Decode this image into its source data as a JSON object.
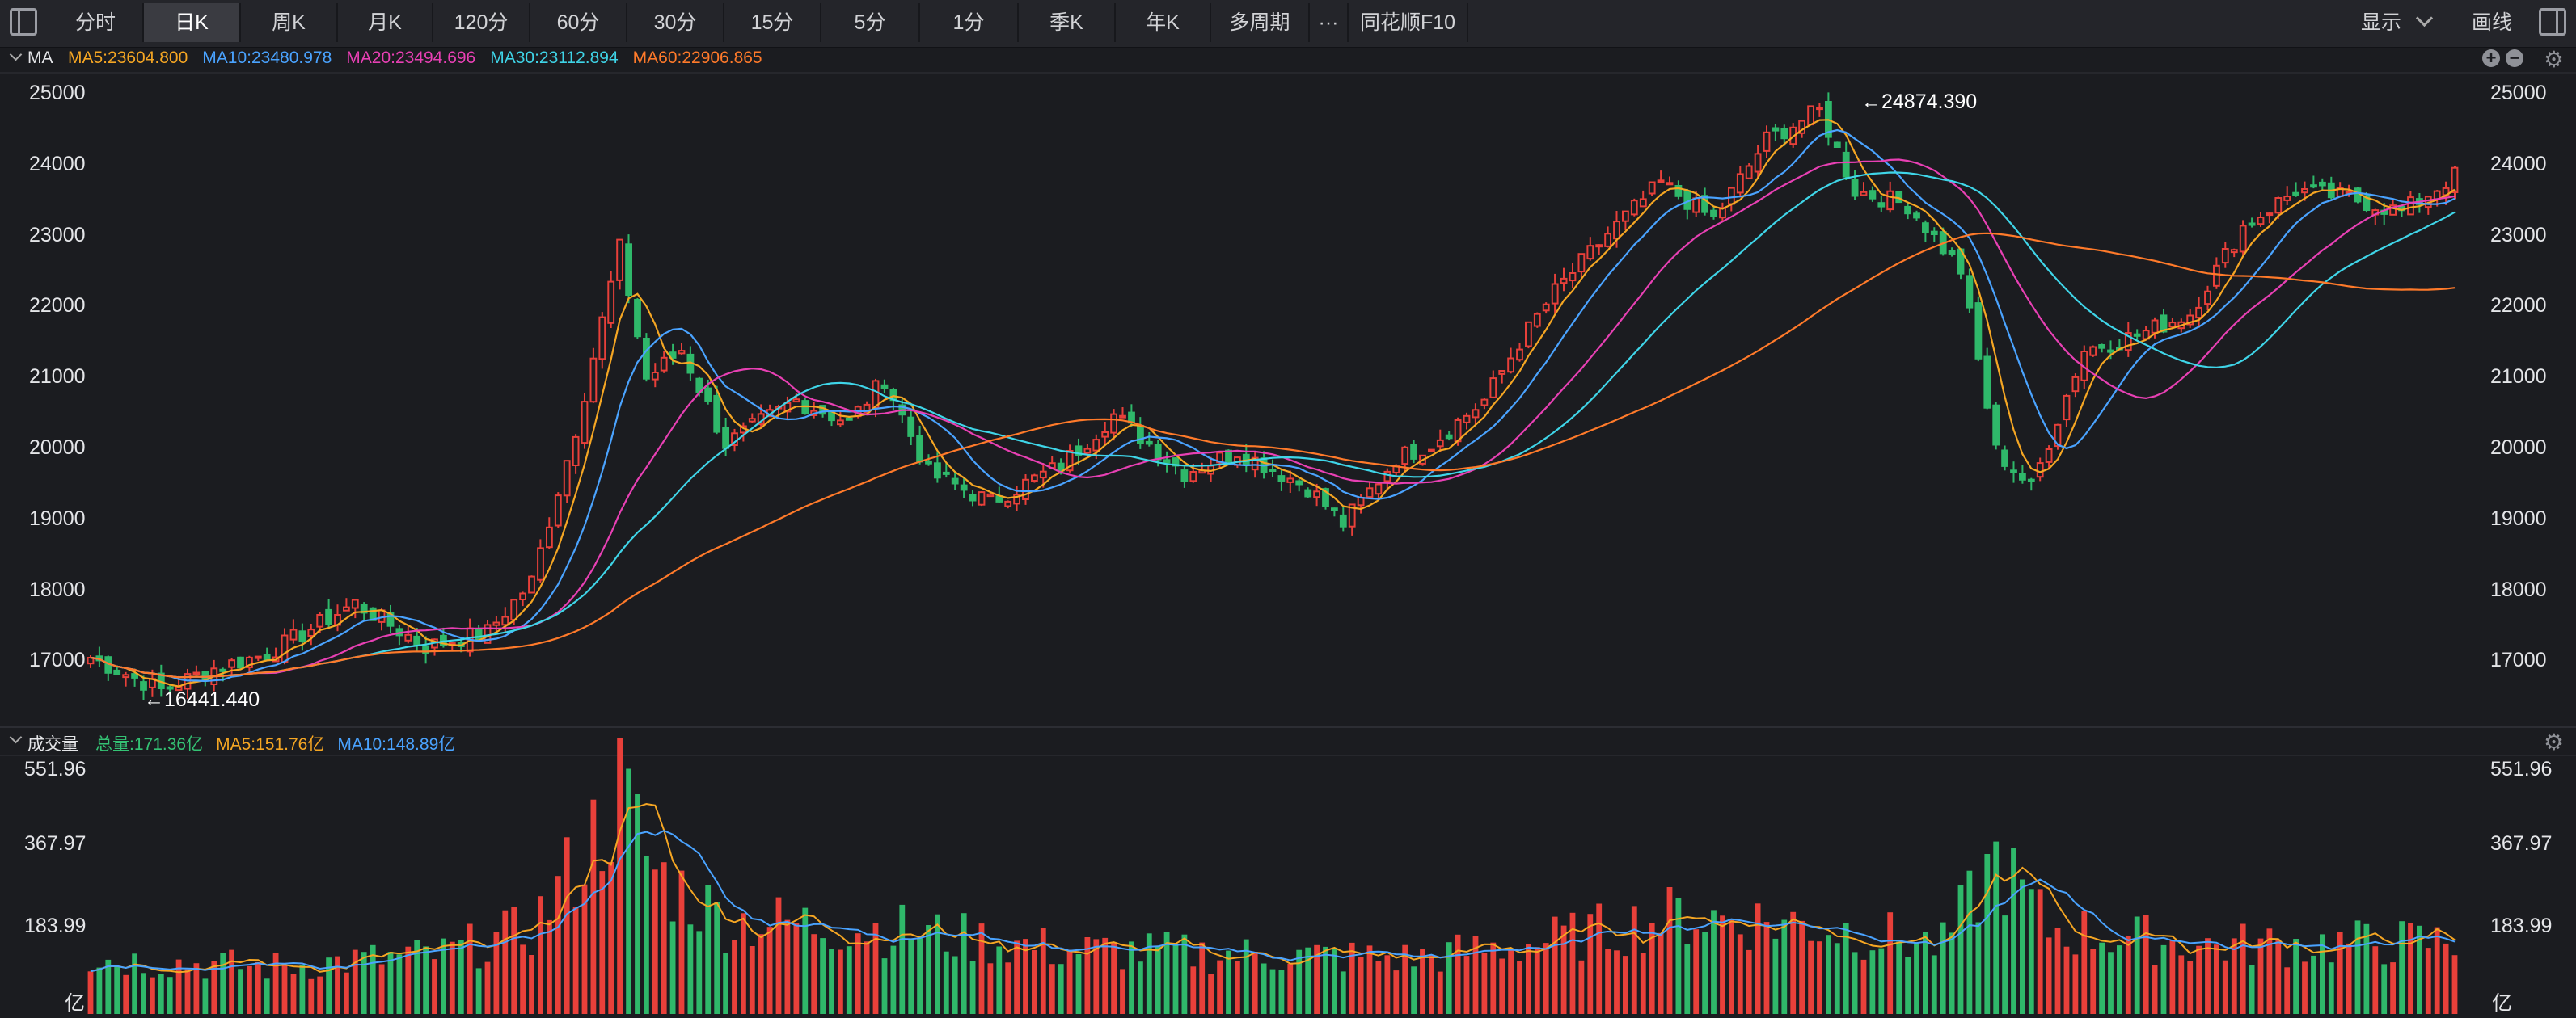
{
  "toolbar": {
    "tabs": [
      "分时",
      "日K",
      "周K",
      "月K",
      "120分",
      "60分",
      "30分",
      "15分",
      "5分",
      "1分",
      "季K",
      "年K",
      "多周期"
    ],
    "active_tab": "日K",
    "more_label": "···",
    "f10_label": "同花顺F10",
    "display_label": "显示",
    "draw_label": "画线"
  },
  "price_panel": {
    "title": "MA",
    "ma_labels": [
      {
        "text": "MA5:23604.800",
        "color": "#f5a623"
      },
      {
        "text": "MA10:23480.978",
        "color": "#4aa3ff"
      },
      {
        "text": "MA20:23494.696",
        "color": "#e840b4"
      },
      {
        "text": "MA30:23112.894",
        "color": "#3fd5e8"
      },
      {
        "text": "MA60:22906.865",
        "color": "#ff7a2a"
      }
    ],
    "y_ticks": [
      "25000",
      "24000",
      "23000",
      "22000",
      "21000",
      "20000",
      "19000",
      "18000",
      "17000"
    ],
    "high_label": "←24874.390",
    "low_label": "←16441.440"
  },
  "volume_panel": {
    "title": "成交量",
    "labels": [
      {
        "text": "总量:171.36亿",
        "color": "#34c274"
      },
      {
        "text": "MA5:151.76亿",
        "color": "#f5a623"
      },
      {
        "text": "MA10:148.89亿",
        "color": "#4aa3ff"
      }
    ],
    "y_ticks": [
      "551.96",
      "367.97",
      "183.99"
    ],
    "unit": "亿"
  },
  "colors": {
    "up": "#e8403a",
    "down": "#2fb86a",
    "ma5": "#f5a623",
    "ma10": "#4aa3ff",
    "ma20": "#e840b4",
    "ma30": "#3fd5e8",
    "ma60": "#ff7a2a"
  },
  "icons": [
    "sidebar-toggle-icon",
    "chevron-down-icon",
    "sidebar-right-icon",
    "zoom-in-icon",
    "zoom-out-icon",
    "settings-gear-icon"
  ],
  "chart_data": {
    "type": "candlestick",
    "candle_count": 160,
    "price_range": [
      16441.44,
      24874.39
    ],
    "y_axis_range": [
      16300,
      25200
    ],
    "volume_axis_range": [
      0,
      600
    ],
    "anchors": [
      {
        "i": 0,
        "close": 17150
      },
      {
        "i": 8,
        "close": 16700
      },
      {
        "i": 14,
        "close": 17000
      },
      {
        "i": 20,
        "close": 17200
      },
      {
        "i": 30,
        "close": 17900
      },
      {
        "i": 38,
        "close": 17300
      },
      {
        "i": 45,
        "close": 17500
      },
      {
        "i": 50,
        "close": 18200
      },
      {
        "i": 55,
        "close": 20300
      },
      {
        "i": 60,
        "close": 22800
      },
      {
        "i": 63,
        "close": 21000
      },
      {
        "i": 67,
        "close": 21400
      },
      {
        "i": 72,
        "close": 20100
      },
      {
        "i": 80,
        "close": 20700
      },
      {
        "i": 86,
        "close": 20400
      },
      {
        "i": 90,
        "close": 21000
      },
      {
        "i": 95,
        "close": 19700
      },
      {
        "i": 102,
        "close": 19300
      },
      {
        "i": 110,
        "close": 19800
      },
      {
        "i": 116,
        "close": 20500
      },
      {
        "i": 124,
        "close": 19700
      },
      {
        "i": 130,
        "close": 20000
      },
      {
        "i": 138,
        "close": 19500
      },
      {
        "i": 142,
        "close": 19000
      },
      {
        "i": 148,
        "close": 19900
      },
      {
        "i": 152,
        "close": 20100
      },
      {
        "i": 158,
        "close": 20700
      },
      {
        "i": 162,
        "close": 21500
      },
      {
        "i": 166,
        "close": 22200
      },
      {
        "i": 172,
        "close": 23000
      },
      {
        "i": 178,
        "close": 23700
      },
      {
        "i": 184,
        "close": 23200
      },
      {
        "i": 190,
        "close": 24300
      },
      {
        "i": 196,
        "close": 24700
      },
      {
        "i": 200,
        "close": 23600
      },
      {
        "i": 206,
        "close": 23400
      },
      {
        "i": 212,
        "close": 22500
      },
      {
        "i": 216,
        "close": 20000
      },
      {
        "i": 220,
        "close": 19500
      },
      {
        "i": 226,
        "close": 21400
      },
      {
        "i": 232,
        "close": 21600
      },
      {
        "i": 238,
        "close": 21900
      },
      {
        "i": 244,
        "close": 23100
      },
      {
        "i": 250,
        "close": 23600
      },
      {
        "i": 256,
        "close": 23500
      },
      {
        "i": 262,
        "close": 23300
      },
      {
        "i": 268,
        "close": 23800
      }
    ],
    "volume_anchors": [
      {
        "i": 0,
        "v": 130
      },
      {
        "i": 20,
        "v": 110
      },
      {
        "i": 40,
        "v": 140
      },
      {
        "i": 50,
        "v": 200
      },
      {
        "i": 56,
        "v": 380
      },
      {
        "i": 60,
        "v": 520
      },
      {
        "i": 64,
        "v": 330
      },
      {
        "i": 72,
        "v": 220
      },
      {
        "i": 90,
        "v": 200
      },
      {
        "i": 110,
        "v": 150
      },
      {
        "i": 130,
        "v": 140
      },
      {
        "i": 150,
        "v": 130
      },
      {
        "i": 165,
        "v": 170
      },
      {
        "i": 180,
        "v": 230
      },
      {
        "i": 195,
        "v": 210
      },
      {
        "i": 210,
        "v": 160
      },
      {
        "i": 216,
        "v": 360
      },
      {
        "i": 222,
        "v": 200
      },
      {
        "i": 240,
        "v": 160
      },
      {
        "i": 268,
        "v": 170
      }
    ]
  }
}
